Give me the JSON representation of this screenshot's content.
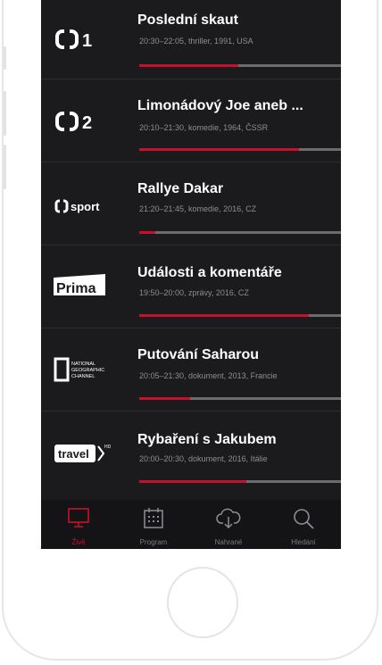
{
  "channels": [
    {
      "logo": "ČT1",
      "title": "Poslední skaut",
      "meta": "20:30–22:05, thriller, 1991, USA",
      "progress": 0.49
    },
    {
      "logo": "ČT2",
      "title": "Limonádový Joe aneb ...",
      "meta": "20:10–21:30, komedie, 1964, ČSSR",
      "progress": 0.79
    },
    {
      "logo": "ČT sport",
      "title": "Rallye Dakar",
      "meta": "21:20–21:45, komedie, 2016, CZ",
      "progress": 0.08
    },
    {
      "logo": "Prima",
      "title": "Události a komentáře",
      "meta": "19:50–20:00, zprávy, 2016, CZ",
      "progress": 0.84
    },
    {
      "logo": "National Geographic Channel",
      "title": "Putování Saharou",
      "meta": "20:05–21:30, dokument, 2013, Francie",
      "progress": 0.25
    },
    {
      "logo": "travel",
      "title": "Rybaření s Jakubem",
      "meta": "20:00–20:30, dokument, 2016, Itálie",
      "progress": 0.53
    }
  ],
  "tabs": [
    {
      "label": "Živě",
      "icon": "tv-icon",
      "active": true
    },
    {
      "label": "Program",
      "icon": "calendar-icon",
      "active": false
    },
    {
      "label": "Nahrané",
      "icon": "cloud-download-icon",
      "active": false
    },
    {
      "label": "Hledání",
      "icon": "search-icon",
      "active": false
    }
  ],
  "colors": {
    "accent": "#c8102e",
    "background": "#1b1b1d",
    "tabbar": "#141416"
  }
}
